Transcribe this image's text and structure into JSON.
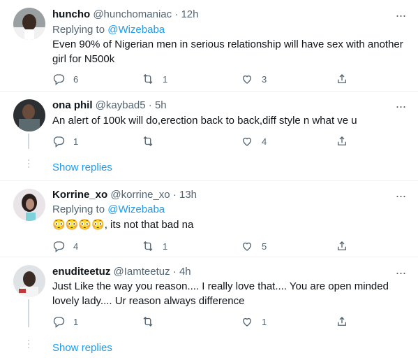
{
  "tweets": [
    {
      "name": "huncho",
      "handle": "@hunchomaniac",
      "time": "12h",
      "replying_prefix": "Replying to ",
      "replying_to": "@Wizebaba",
      "text": "Even 90% of Nigerian men in serious relationship will have sex with another girl for N500k",
      "replies": "6",
      "retweets": "1",
      "likes": "3"
    },
    {
      "name": "ona phil",
      "handle": "@kaybad5",
      "time": "5h",
      "text": "An alert of 100k will do,erection  back to back,diff style n what ve u",
      "replies": "1",
      "retweets": "",
      "likes": "4"
    },
    {
      "name": "Korrine_xo",
      "handle": "@korrine_xo",
      "time": "13h",
      "replying_prefix": "Replying to ",
      "replying_to": "@Wizebaba",
      "emojis": "😳😳😳😳",
      "text": ", its not that bad na",
      "replies": "4",
      "retweets": "1",
      "likes": "5"
    },
    {
      "name": "enuditeetuz",
      "handle": "@Iamteetuz",
      "time": "4h",
      "text": "Just Like the way you reason.... I really love that.... You are open minded lovely lady.... Ur reason always difference",
      "replies": "1",
      "retweets": "",
      "likes": "1"
    }
  ],
  "dot_separator": "·",
  "more_label": "···",
  "show_replies_label": "Show replies",
  "colors": {
    "accent": "#1d9bf0",
    "secondary_text": "#536471",
    "primary_text": "#0f1419",
    "divider": "#eff3f4"
  },
  "icons": [
    "reply-icon",
    "retweet-icon",
    "like-icon",
    "share-icon",
    "more-icon"
  ]
}
